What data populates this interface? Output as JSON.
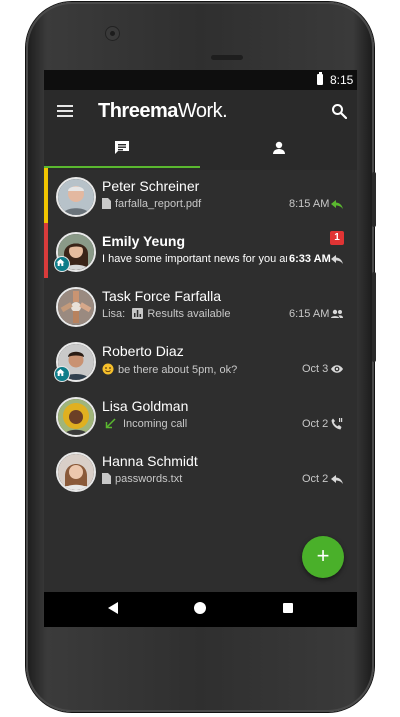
{
  "status_bar": {
    "time": "8:15"
  },
  "app_bar": {
    "logo_main": "Threema",
    "logo_suffix": "Work.",
    "menu_icon": "menu-icon",
    "search_icon": "search-icon"
  },
  "tabs": [
    {
      "name": "chats",
      "icon": "chat-icon",
      "selected": true
    },
    {
      "name": "contacts",
      "icon": "person-icon",
      "selected": false
    }
  ],
  "colors": {
    "accent": "#5ab82f",
    "fab": "#4ab02a",
    "unread_badge": "#e03434",
    "work_badge": "#0e7d8a",
    "status_yellow": "#f2c500",
    "status_red": "#d93b3b",
    "status_green": "#5ab82f"
  },
  "conversations": [
    {
      "name": "Peter Schreiner",
      "preview": "farfalla_report.pdf",
      "preview_icon": "file-icon",
      "date": "8:15 AM",
      "state_icon": "reply-icon",
      "state_color": "#5ab82f",
      "bar": "#f2c500"
    },
    {
      "name": "Emily Yeung",
      "preview": "I have some important news for you and",
      "date": "6:33 AM",
      "state_icon": "reply-icon",
      "unread": "1",
      "bar": "#d93b3b",
      "bold": true,
      "work": true
    },
    {
      "name": "Task Force Farfalla",
      "preview_sender": "Lisa:",
      "preview": "Results available",
      "preview_icon": "poll-icon",
      "date": "6:15 AM",
      "state_icon": "group-icon"
    },
    {
      "name": "Roberto Diaz",
      "preview": "be there about 5pm, ok?",
      "preview_icon": "emoji-icon",
      "date": "Oct 3",
      "state_icon": "eye-icon",
      "work": true
    },
    {
      "name": "Lisa Goldman",
      "preview": "Incoming call",
      "preview_icon": "incoming-call-icon",
      "date": "Oct 2",
      "state_icon": "phone-icon"
    },
    {
      "name": "Hanna Schmidt",
      "preview": "passwords.txt",
      "preview_icon": "file-icon",
      "date": "Oct 2",
      "state_icon": "reply-icon"
    }
  ],
  "fab": {
    "label": "+"
  },
  "nav_bar": {
    "back": "back-icon",
    "home": "home-icon",
    "recents": "recents-icon"
  }
}
